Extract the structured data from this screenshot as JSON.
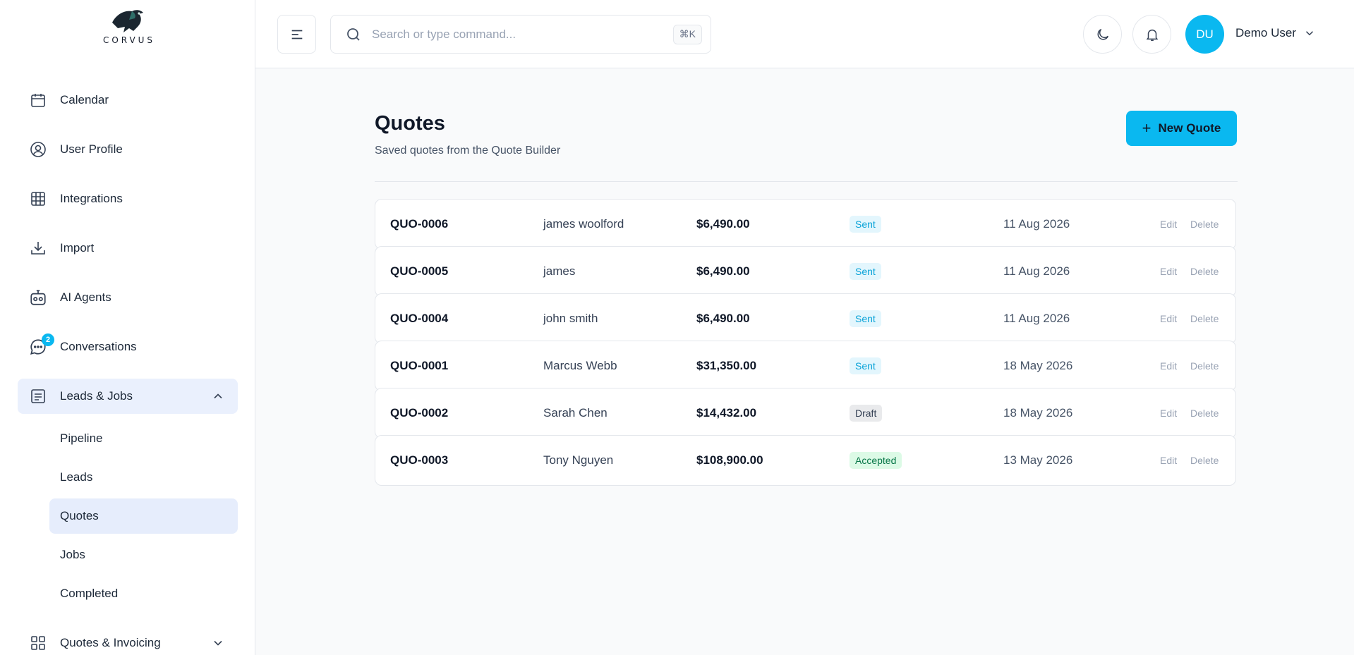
{
  "brand": {
    "name": "CORVUS"
  },
  "sidebar": {
    "items": [
      {
        "label": "Calendar",
        "icon": "calendar-icon"
      },
      {
        "label": "User Profile",
        "icon": "user-circle-icon"
      },
      {
        "label": "Integrations",
        "icon": "grid-icon"
      },
      {
        "label": "Import",
        "icon": "download-icon"
      },
      {
        "label": "AI Agents",
        "icon": "robot-icon"
      },
      {
        "label": "Conversations",
        "icon": "chat-icon",
        "badge": "2"
      },
      {
        "label": "Leads & Jobs",
        "icon": "list-icon",
        "expanded": true
      }
    ],
    "sub_items": [
      "Pipeline",
      "Leads",
      "Quotes",
      "Jobs",
      "Completed"
    ],
    "active_sub": "Quotes",
    "bottom_item": {
      "label": "Quotes & Invoicing",
      "icon": "apps-icon"
    }
  },
  "header": {
    "search_placeholder": "Search or type command...",
    "shortcut": "⌘K",
    "avatar_initials": "DU",
    "user_name": "Demo User"
  },
  "main": {
    "title": "Quotes",
    "subtitle": "Saved quotes from the Quote Builder",
    "new_button": "New Quote",
    "edit_label": "Edit",
    "delete_label": "Delete",
    "quotes": [
      {
        "id": "QUO-0006",
        "customer": "james woolford",
        "amount": "$6,490.00",
        "status": "Sent",
        "status_type": "sent",
        "date": "11 Aug 2026"
      },
      {
        "id": "QUO-0005",
        "customer": "james",
        "amount": "$6,490.00",
        "status": "Sent",
        "status_type": "sent",
        "date": "11 Aug 2026"
      },
      {
        "id": "QUO-0004",
        "customer": "john smith",
        "amount": "$6,490.00",
        "status": "Sent",
        "status_type": "sent",
        "date": "11 Aug 2026"
      },
      {
        "id": "QUO-0001",
        "customer": "Marcus Webb",
        "amount": "$31,350.00",
        "status": "Sent",
        "status_type": "sent",
        "date": "18 May 2026"
      },
      {
        "id": "QUO-0002",
        "customer": "Sarah Chen",
        "amount": "$14,432.00",
        "status": "Draft",
        "status_type": "draft",
        "date": "18 May 2026"
      },
      {
        "id": "QUO-0003",
        "customer": "Tony Nguyen",
        "amount": "$108,900.00",
        "status": "Accepted",
        "status_type": "accepted",
        "date": "13 May 2026"
      }
    ]
  },
  "colors": {
    "accent": "#0ab8f0",
    "active_bg": "#e6edfc",
    "sent": "#0aa3d8",
    "accepted": "#067647"
  }
}
